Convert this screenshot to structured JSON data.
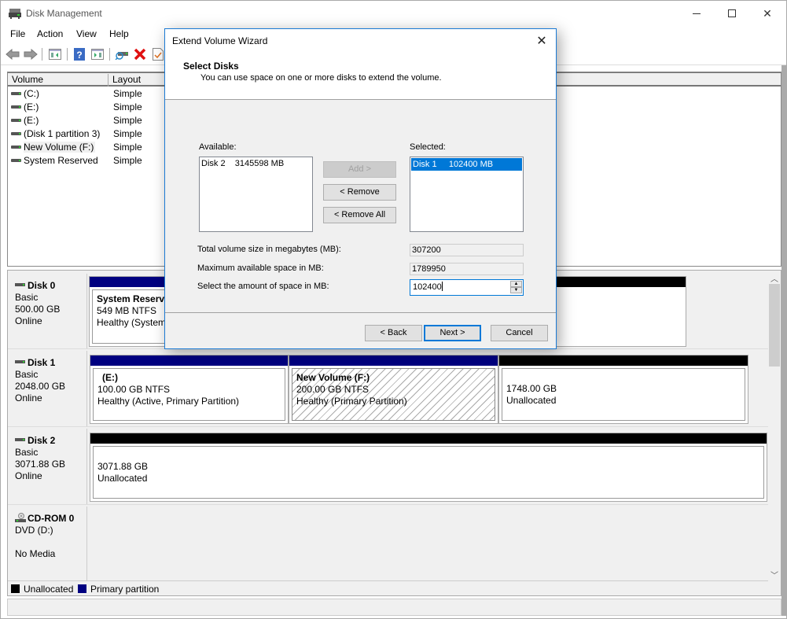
{
  "window": {
    "title": "Disk Management",
    "controls": [
      "minimize",
      "maximize",
      "close"
    ]
  },
  "menu": [
    "File",
    "Action",
    "View",
    "Help"
  ],
  "toolbar": [
    {
      "icon": "back-arrow-icon"
    },
    {
      "icon": "forward-arrow-icon"
    },
    {
      "icon": "show-hide-console-tree-icon"
    },
    {
      "icon": "help-icon"
    },
    {
      "icon": "show-hide-action-pane-icon"
    },
    {
      "icon": "connect-drive-icon"
    },
    {
      "icon": "delete-icon"
    },
    {
      "icon": "properties-icon"
    }
  ],
  "volume_list": {
    "columns": [
      "Volume",
      "Layout"
    ],
    "rows": [
      {
        "volume": "(C:)",
        "layout": "Simple"
      },
      {
        "volume": "(E:)",
        "layout": "Simple"
      },
      {
        "volume": "(E:)",
        "layout": "Simple"
      },
      {
        "volume": "(Disk 1 partition 3)",
        "layout": "Simple"
      },
      {
        "volume": "New Volume (F:)",
        "layout": "Simple"
      },
      {
        "volume": "System Reserved",
        "layout": "Simple"
      }
    ]
  },
  "disks": [
    {
      "name": "Disk 0",
      "type": "Basic",
      "size": "500.00 GB",
      "status": "Online",
      "partitions": [
        {
          "name": "System Reserve",
          "size": "549 MB NTFS",
          "status": "Healthy (System,",
          "kind": "primary"
        }
      ]
    },
    {
      "name": "Disk 1",
      "type": "Basic",
      "size": "2048.00 GB",
      "status": "Online",
      "partitions": [
        {
          "name": "(E:)",
          "size": "100.00 GB NTFS",
          "status": "Healthy (Active, Primary Partition)",
          "kind": "primary"
        },
        {
          "name": "New Volume  (F:)",
          "size": "200.00 GB NTFS",
          "status": "Healthy (Primary Partition)",
          "kind": "primary-selected"
        },
        {
          "name": "",
          "size": "1748.00 GB",
          "status": "Unallocated",
          "kind": "unallocated"
        }
      ]
    },
    {
      "name": "Disk 2",
      "type": "Basic",
      "size": "3071.88 GB",
      "status": "Online",
      "partitions": [
        {
          "name": "",
          "size": "3071.88 GB",
          "status": "Unallocated",
          "kind": "unallocated"
        }
      ]
    },
    {
      "name": "CD-ROM 0",
      "type": "DVD (D:)",
      "size": "",
      "status": "No Media",
      "partitions": []
    }
  ],
  "legend": [
    {
      "label": "Unallocated",
      "color": "#000000"
    },
    {
      "label": "Primary partition",
      "color": "#000080"
    }
  ],
  "colors": {
    "primary": "#000080",
    "unallocated": "#000000",
    "accent": "#0078d7",
    "highlight_box": "#e8201f"
  },
  "dialog": {
    "title": "Extend Volume Wizard",
    "heading": "Select Disks",
    "subheading": "You can use space on one or more disks to extend the volume.",
    "available_label": "Available:",
    "available_items": [
      "Disk 2    3145598 MB"
    ],
    "selected_label": "Selected:",
    "selected_items": [
      "Disk 1     102400 MB"
    ],
    "add_button": "Add >",
    "remove_button": "< Remove",
    "remove_all_button": "< Remove All",
    "total_label": "Total volume size in megabytes (MB):",
    "total_value": "307200",
    "max_label": "Maximum available space in MB:",
    "max_value": "1789950",
    "amount_label": "Select the amount of space in MB:",
    "amount_value": "102400",
    "back_button": "< Back",
    "next_button": "Next >",
    "cancel_button": "Cancel"
  }
}
